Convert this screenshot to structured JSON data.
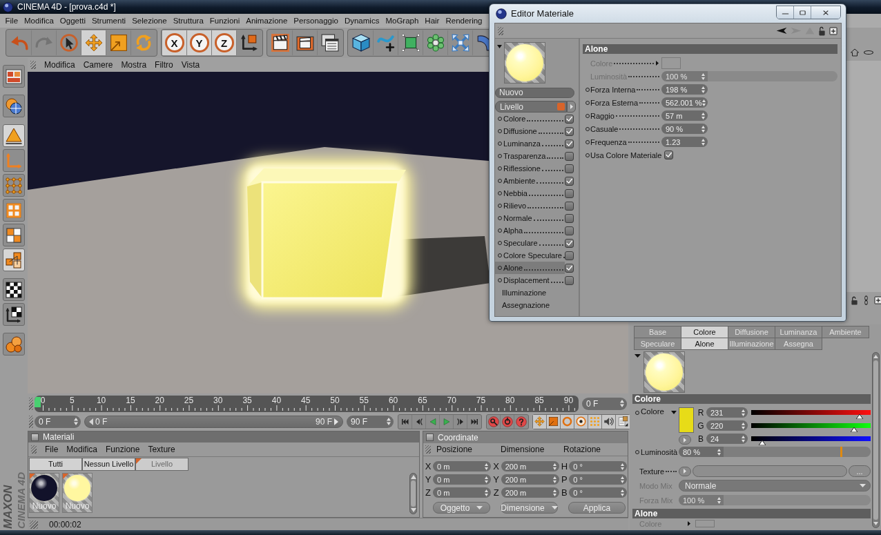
{
  "window": {
    "title": "CINEMA 4D - [prova.c4d *]"
  },
  "menu": [
    "File",
    "Modifica",
    "Oggetti",
    "Strumenti",
    "Selezione",
    "Struttura",
    "Funzioni",
    "Animazione",
    "Personaggio",
    "Dynamics",
    "MoGraph",
    "Hair",
    "Rendering"
  ],
  "toolbar": {
    "groups": [
      {
        "tools": [
          {
            "selected": false,
            "disabled": false
          },
          {
            "selected": false,
            "disabled": true
          },
          {
            "selected": false,
            "disabled": false
          },
          {
            "selected": true,
            "disabled": false
          },
          {
            "selected": false,
            "disabled": false
          },
          {
            "selected": false,
            "disabled": false
          }
        ]
      },
      {
        "tools": [
          {
            "label": "X",
            "selected": true,
            "disabled": false
          },
          {
            "label": "Y",
            "selected": true,
            "disabled": false
          },
          {
            "label": "Z",
            "selected": true,
            "disabled": false
          },
          {
            "selected": false,
            "disabled": false
          }
        ]
      },
      {
        "tools": [
          {
            "selected": false,
            "disabled": false
          },
          {
            "selected": false,
            "disabled": false
          },
          {
            "selected": false,
            "disabled": false
          }
        ]
      },
      {
        "tools": [
          {
            "selected": false,
            "disabled": false
          },
          {
            "selected": false,
            "disabled": false
          },
          {
            "selected": false,
            "disabled": false
          },
          {
            "selected": false,
            "disabled": false
          },
          {
            "selected": false,
            "disabled": false
          },
          {
            "selected": false,
            "disabled": false
          }
        ]
      }
    ]
  },
  "left_toolbar": {
    "tools": [
      {
        "selected": false
      },
      {
        "selected": false
      },
      {
        "selected": true
      },
      {
        "selected": false
      },
      {
        "selected": false
      },
      {
        "selected": false
      },
      {
        "selected": false
      },
      {
        "selected": true
      },
      {
        "selected": false
      },
      {
        "selected": false
      },
      {
        "selected": false
      }
    ]
  },
  "viewport": {
    "menu": [
      "Modifica",
      "Camere",
      "Mostra",
      "Filtro",
      "Vista"
    ]
  },
  "timeline": {
    "labels": [
      "0",
      "5",
      "10",
      "15",
      "20",
      "25",
      "30",
      "35",
      "40",
      "45",
      "50",
      "55",
      "60",
      "65",
      "70",
      "75",
      "80",
      "85",
      "90"
    ],
    "level": 0,
    "frame": "0 F"
  },
  "playback": {
    "start": "0 F",
    "range_start": "0 F",
    "range_end": "90 F",
    "end": "90 F"
  },
  "materials_panel": {
    "title": "Materiali",
    "menu": [
      "File",
      "Modifica",
      "Funzione",
      "Texture"
    ],
    "tabs": [
      {
        "label": "Tutti",
        "disabled": false
      },
      {
        "label": "Nessun Livello",
        "disabled": false
      },
      {
        "label": "Livello",
        "disabled": true
      }
    ],
    "materials": [
      {
        "name": "Nuovo",
        "color": "#12122a"
      },
      {
        "name": "Nuovo",
        "color": "#fff7a0"
      }
    ]
  },
  "coordinates": {
    "title": "Coordinate",
    "columns": [
      "Posizione",
      "Dimensione",
      "Rotazione"
    ],
    "rows": [
      {
        "cells": [
          {
            "axis": "X",
            "value": "0 m"
          },
          {
            "axis": "X",
            "value": "200 m"
          },
          {
            "axis": "H",
            "value": "0 °"
          }
        ]
      },
      {
        "cells": [
          {
            "axis": "Y",
            "value": "0 m"
          },
          {
            "axis": "Y",
            "value": "200 m"
          },
          {
            "axis": "P",
            "value": "0 °"
          }
        ]
      },
      {
        "cells": [
          {
            "axis": "Z",
            "value": "0 m"
          },
          {
            "axis": "Z",
            "value": "200 m"
          },
          {
            "axis": "B",
            "value": "0 °"
          }
        ]
      }
    ],
    "dropdowns": [
      "Oggetto",
      "Dimensione"
    ],
    "apply": "Applica"
  },
  "status_bar": {
    "time": "00:00:02"
  },
  "logo": {
    "brand": "MAXON",
    "product": "CINEMA 4D"
  },
  "attributes": {
    "tabs": [
      {
        "label": "Base",
        "selected": false
      },
      {
        "label": "Colore",
        "selected": true
      },
      {
        "label": "Diffusione",
        "selected": false
      },
      {
        "label": "Luminanza",
        "selected": false
      },
      {
        "label": "Ambiente",
        "selected": false
      },
      {
        "label": "Speculare",
        "selected": false
      },
      {
        "label": "Alone",
        "selected": true
      },
      {
        "label": "Illuminazione",
        "selected": false
      },
      {
        "label": "Assegna",
        "selected": false
      }
    ],
    "color_section": {
      "title": "Colore",
      "label": "Colore",
      "channels": [
        {
          "name": "R",
          "value": "231",
          "level": 0.906
        },
        {
          "name": "G",
          "value": "220",
          "level": 0.863
        },
        {
          "name": "B",
          "value": "24",
          "level": 0.094
        }
      ],
      "brightness": {
        "label": "Luminosità",
        "value": "80 %",
        "level": 0.8
      },
      "texture": {
        "label": "Texture",
        "browse": "..."
      },
      "mix_mode": {
        "label": "Modo Mix",
        "value": "Normale",
        "disabled": true
      },
      "mix_strength": {
        "label": "Forza Mix",
        "value": "100 %",
        "disabled": true
      }
    },
    "glow_section": {
      "title": "Alone",
      "label": "Colore"
    }
  },
  "material_editor": {
    "title": "Editor Materiale",
    "name": "Nuovo",
    "layer": "Livello",
    "channels": [
      {
        "label": "Colore",
        "checked": true,
        "selected": false
      },
      {
        "label": "Diffusione",
        "checked": true,
        "selected": false
      },
      {
        "label": "Luminanza",
        "checked": true,
        "selected": false
      },
      {
        "label": "Trasparenza",
        "checked": false,
        "selected": false
      },
      {
        "label": "Riflessione",
        "checked": false,
        "selected": false
      },
      {
        "label": "Ambiente",
        "checked": true,
        "selected": false
      },
      {
        "label": "Nebbia",
        "checked": false,
        "selected": false
      },
      {
        "label": "Rilievo",
        "checked": false,
        "selected": false
      },
      {
        "label": "Normale",
        "checked": false,
        "selected": false
      },
      {
        "label": "Alpha",
        "checked": false,
        "selected": false
      },
      {
        "label": "Speculare",
        "checked": true,
        "selected": false
      },
      {
        "label": "Colore Speculare",
        "checked": false,
        "selected": false
      },
      {
        "label": "Alone",
        "checked": true,
        "selected": true
      },
      {
        "label": "Displacement",
        "checked": false,
        "selected": false
      }
    ],
    "pages": [
      {
        "label": "Illuminazione",
        "selected": false
      },
      {
        "label": "Assegnazione",
        "selected": false
      }
    ],
    "section": "Alone",
    "params": [
      {
        "kind": "color",
        "label": "Colore",
        "disabled": true
      },
      {
        "kind": "slider",
        "label": "Luminosità",
        "value": "100 %",
        "disabled": true
      },
      {
        "kind": "number",
        "label": "Forza Interna",
        "value": "198 %",
        "disabled": false
      },
      {
        "kind": "number",
        "label": "Forza Esterna",
        "value": "562.001 %",
        "disabled": false
      },
      {
        "kind": "number",
        "label": "Raggio",
        "value": "57 m",
        "disabled": false
      },
      {
        "kind": "number",
        "label": "Casuale",
        "value": "90 %",
        "disabled": false
      },
      {
        "kind": "number",
        "label": "Frequenza",
        "value": "1.23",
        "disabled": false
      },
      {
        "kind": "checkbox",
        "label": "Usa Colore Materiale",
        "checked": true,
        "disabled": false
      }
    ]
  }
}
